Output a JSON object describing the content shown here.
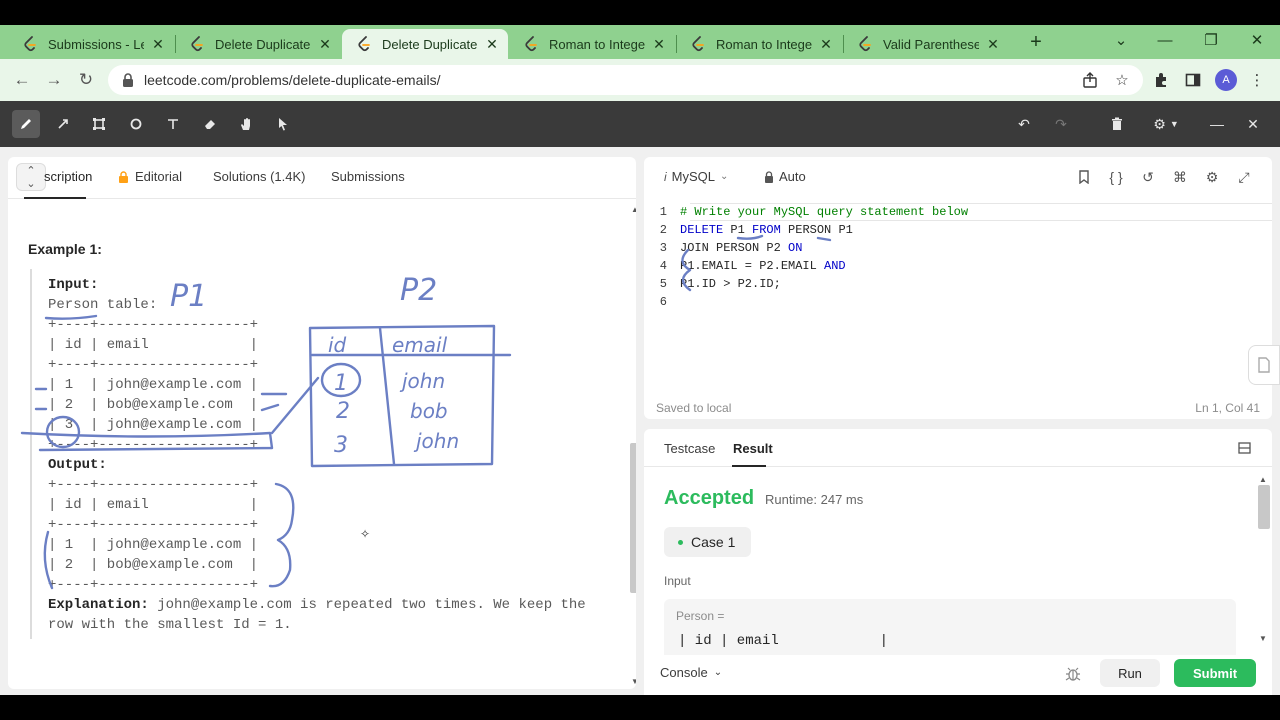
{
  "browser": {
    "tabs": [
      {
        "title": "Submissions - LeetCode",
        "active": false
      },
      {
        "title": "Delete Duplicate Emails",
        "active": false
      },
      {
        "title": "Delete Duplicate Emails",
        "active": true
      },
      {
        "title": "Roman to Integer",
        "active": false
      },
      {
        "title": "Roman to Integer",
        "active": false
      },
      {
        "title": "Valid Parentheses",
        "active": false
      }
    ],
    "url": "leetcode.com/problems/delete-duplicate-emails/",
    "avatar_letter": "A",
    "colors": {
      "tabbar": "#8fd18f",
      "active_tab": "#e9f6e9"
    }
  },
  "annotation_toolbar": {
    "tools": [
      "pen-icon",
      "line-icon",
      "crop-icon",
      "circle-icon",
      "text-icon",
      "eraser-icon",
      "hand-icon",
      "pointer-icon"
    ],
    "active_tool": "pen-icon",
    "right_tools": [
      "undo-icon",
      "redo-icon",
      "trash-icon",
      "settings-icon",
      "minimize-icon",
      "close-icon"
    ]
  },
  "problem_panel": {
    "tabs": [
      {
        "label": "scription",
        "active": true
      },
      {
        "label": "Editorial",
        "locked": true
      },
      {
        "label": "Solutions (1.4K)"
      },
      {
        "label": "Submissions"
      }
    ],
    "example_title": "Example 1:",
    "input_label": "Input:",
    "person_table_label": "Person table:",
    "input_table": [
      "+----+------------------+",
      "| id | email            |",
      "+----+------------------+",
      "| 1  | john@example.com |",
      "| 2  | bob@example.com  |",
      "| 3  | john@example.com |",
      "+----+------------------+"
    ],
    "output_label": "Output:",
    "output_table": [
      "+----+------------------+",
      "| id | email            |",
      "+----+------------------+",
      "| 1  | john@example.com |",
      "| 2  | bob@example.com  |",
      "+----+------------------+"
    ],
    "explanation_label": "Explanation:",
    "explanation_line1": " john@example.com is repeated two times. We keep the",
    "explanation_line2": "row with the smallest Id = 1."
  },
  "editor": {
    "language": "MySQL",
    "auto_label": "Auto",
    "lines": [
      {
        "n": "1",
        "parts": [
          {
            "t": "# Write your MySQL query statement below",
            "c": "cm"
          }
        ]
      },
      {
        "n": "2",
        "parts": [
          {
            "t": "DELETE",
            "c": "kw"
          },
          {
            "t": " P1 ",
            "c": ""
          },
          {
            "t": "FROM",
            "c": "kw"
          },
          {
            "t": " PERSON P1",
            "c": ""
          }
        ]
      },
      {
        "n": "3",
        "parts": [
          {
            "t": "JOIN PERSON P2 ",
            "c": ""
          },
          {
            "t": "ON",
            "c": "kw"
          }
        ]
      },
      {
        "n": "4",
        "parts": [
          {
            "t": "P1.EMAIL = P2.EMAIL ",
            "c": ""
          },
          {
            "t": "AND",
            "c": "kw"
          }
        ]
      },
      {
        "n": "5",
        "parts": [
          {
            "t": "P1.ID > P2.ID;",
            "c": ""
          }
        ]
      },
      {
        "n": "6",
        "parts": [
          {
            "t": "",
            "c": ""
          }
        ]
      }
    ],
    "saved_text": "Saved to local",
    "cursor_pos": "Ln 1, Col 41"
  },
  "result_panel": {
    "tabs": [
      {
        "label": "Testcase"
      },
      {
        "label": "Result",
        "active": true
      }
    ],
    "status": "Accepted",
    "runtime": "Runtime: 247 ms",
    "case_label": "Case 1",
    "input_label": "Input",
    "input_var": "Person =",
    "input_value": "| id | email            |"
  },
  "footer": {
    "console_label": "Console",
    "run_label": "Run",
    "submit_label": "Submit"
  },
  "handwriting": {
    "p1_label": "P1",
    "p2_label": "P2",
    "sketch_header_id": "id",
    "sketch_header_email": "email",
    "sketch_ids": [
      "1",
      "2",
      "3"
    ],
    "sketch_emails": [
      "john",
      "bob",
      "john"
    ]
  },
  "colors": {
    "accepted": "#2cbb5d",
    "submit": "#2cbb5d",
    "ink": "#6b7fc4",
    "keyword": "#0000c8",
    "comment": "#008000"
  }
}
